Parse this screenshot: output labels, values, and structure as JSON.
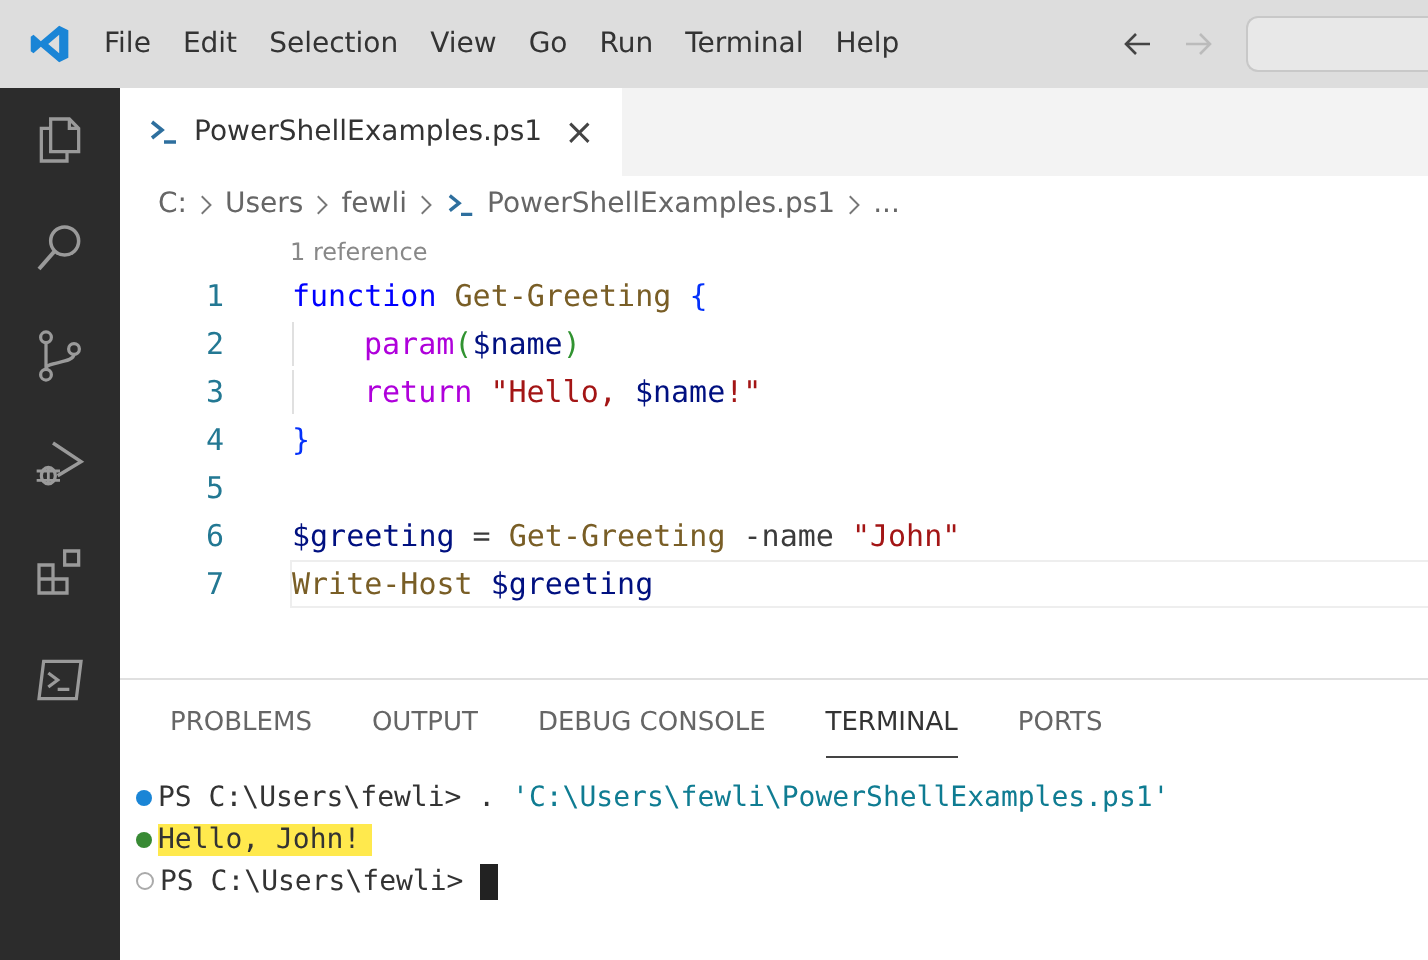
{
  "menu": [
    "File",
    "Edit",
    "Selection",
    "View",
    "Go",
    "Run",
    "Terminal",
    "Help"
  ],
  "nav": {
    "back_disabled": false,
    "forward_disabled": true
  },
  "activity": [
    {
      "selected": false
    },
    {
      "selected": false
    },
    {
      "selected": false
    },
    {
      "selected": false
    },
    {
      "selected": false
    },
    {
      "selected": false
    }
  ],
  "tabs": [
    {
      "label": "PowerShellExamples.ps1",
      "selected": true,
      "close": "×"
    }
  ],
  "breadcrumb": [
    {
      "label": "C:",
      "kind": "folder"
    },
    {
      "label": "Users",
      "kind": "folder"
    },
    {
      "label": "fewli",
      "kind": "folder"
    },
    {
      "label": "PowerShellExamples.ps1",
      "kind": "file"
    },
    {
      "label": "...",
      "kind": "more"
    }
  ],
  "editor": {
    "codelens": "1 reference",
    "lines": [
      {
        "number": "1",
        "current": false,
        "indented": false,
        "tokens": [
          {
            "t": "function ",
            "kind": "keyword"
          },
          {
            "t": "Get-Greeting ",
            "kind": "function"
          },
          {
            "t": "{",
            "kind": "brace"
          }
        ]
      },
      {
        "number": "2",
        "current": false,
        "indented": true,
        "tokens": [
          {
            "t": "param",
            "kind": "control"
          },
          {
            "t": "(",
            "kind": "paren"
          },
          {
            "t": "$name",
            "kind": "variable"
          },
          {
            "t": ")",
            "kind": "paren"
          }
        ]
      },
      {
        "number": "3",
        "current": false,
        "indented": true,
        "tokens": [
          {
            "t": "return ",
            "kind": "control"
          },
          {
            "t": "\"Hello, ",
            "kind": "string"
          },
          {
            "t": "$name",
            "kind": "variable"
          },
          {
            "t": "!\"",
            "kind": "string"
          }
        ]
      },
      {
        "number": "4",
        "current": false,
        "indented": false,
        "tokens": [
          {
            "t": "}",
            "kind": "brace"
          }
        ]
      },
      {
        "number": "5",
        "current": false,
        "indented": false
      },
      {
        "number": "6",
        "current": false,
        "indented": false,
        "tokens": [
          {
            "t": "$greeting",
            "kind": "variable"
          },
          {
            "t": " = ",
            "kind": "plain"
          },
          {
            "t": "Get-Greeting",
            "kind": "function"
          },
          {
            "t": " -name ",
            "kind": "plain"
          },
          {
            "t": "\"John\"",
            "kind": "string"
          }
        ]
      },
      {
        "number": "7",
        "current": true,
        "indented": false,
        "tokens": [
          {
            "t": "Write-Host ",
            "kind": "function"
          },
          {
            "t": "$greeting",
            "kind": "variable"
          }
        ]
      }
    ]
  },
  "panel_tabs": [
    {
      "label": "PROBLEMS",
      "selected": false
    },
    {
      "label": "OUTPUT",
      "selected": false
    },
    {
      "label": "DEBUG CONSOLE",
      "selected": false
    },
    {
      "label": "TERMINAL",
      "selected": true
    },
    {
      "label": "PORTS",
      "selected": false
    }
  ],
  "terminal": [
    {
      "kind": "info",
      "highlighted": false,
      "cursor": false,
      "segments": [
        {
          "t": "PS C:\\Users\\fewli> . ",
          "kind": "plain"
        },
        {
          "t": "'C:\\Users\\fewli\\PowerShellExamples.ps1'",
          "kind": "string"
        }
      ]
    },
    {
      "kind": "success",
      "highlighted": true,
      "cursor": false,
      "segments": [
        {
          "t": "Hello, John!",
          "kind": "plain"
        }
      ]
    },
    {
      "kind": "idle",
      "highlighted": false,
      "cursor": true,
      "segments": [
        {
          "t": "PS C:\\Users\\fewli> ",
          "kind": "plain"
        }
      ]
    }
  ]
}
